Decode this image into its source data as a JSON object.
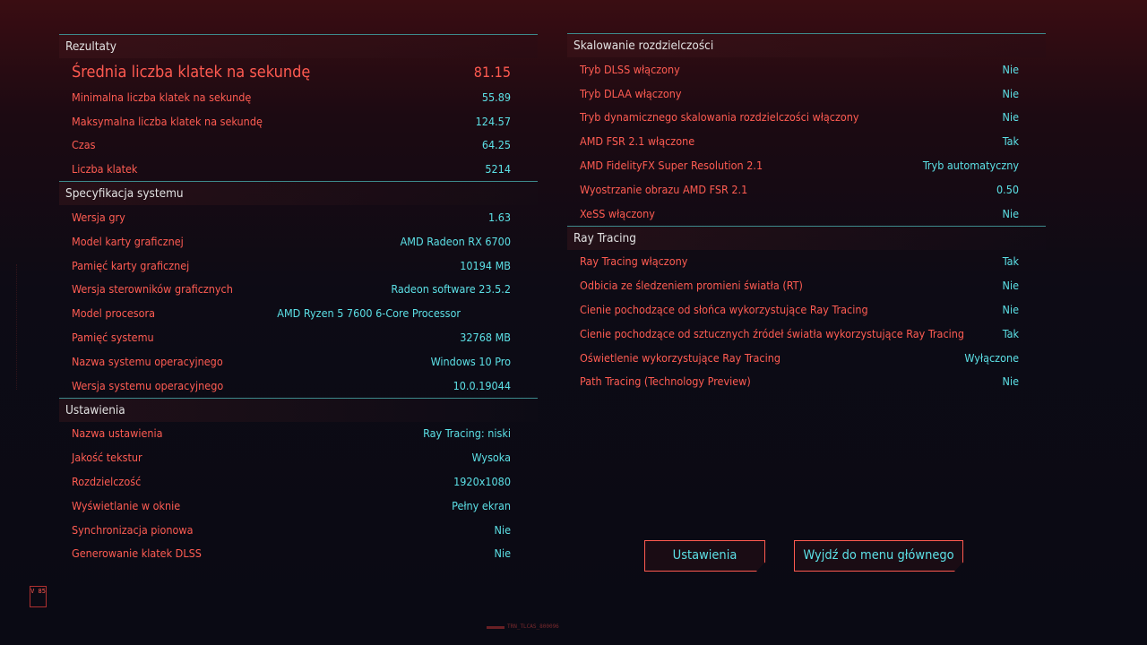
{
  "results": {
    "title": "Rezultaty",
    "rows": [
      {
        "label": "Średnia liczba klatek na sekundę",
        "value": "81.15"
      },
      {
        "label": "Minimalna liczba klatek na sekundę",
        "value": "55.89"
      },
      {
        "label": "Maksymalna liczba klatek na sekundę",
        "value": "124.57"
      },
      {
        "label": "Czas",
        "value": "64.25"
      },
      {
        "label": "Liczba klatek",
        "value": "5214"
      }
    ]
  },
  "system": {
    "title": "Specyfikacja systemu",
    "rows": [
      {
        "label": "Wersja gry",
        "value": "1.63"
      },
      {
        "label": "Model karty graficznej",
        "value": "AMD Radeon RX 6700"
      },
      {
        "label": "Pamięć karty graficznej",
        "value": "10194 MB"
      },
      {
        "label": "Wersja sterowników graficznych",
        "value": "Radeon software 23.5.2"
      },
      {
        "label": "Model procesora",
        "value": "AMD Ryzen 5 7600 6-Core Processor"
      },
      {
        "label": "Pamięć systemu",
        "value": "32768 MB"
      },
      {
        "label": "Nazwa systemu operacyjnego",
        "value": "Windows 10 Pro"
      },
      {
        "label": "Wersja systemu operacyjnego",
        "value": "10.0.19044"
      }
    ]
  },
  "settings": {
    "title": "Ustawienia",
    "rows": [
      {
        "label": "Nazwa ustawienia",
        "value": "Ray Tracing: niski"
      },
      {
        "label": "Jakość tekstur",
        "value": "Wysoka"
      },
      {
        "label": "Rozdzielczość",
        "value": "1920x1080"
      },
      {
        "label": "Wyświetlanie w oknie",
        "value": "Pełny ekran"
      },
      {
        "label": "Synchronizacja pionowa",
        "value": "Nie"
      },
      {
        "label": "Generowanie klatek DLSS",
        "value": "Nie"
      }
    ]
  },
  "scaling": {
    "title": "Skalowanie rozdzielczości",
    "rows": [
      {
        "label": "Tryb DLSS włączony",
        "value": "Nie"
      },
      {
        "label": "Tryb DLAA włączony",
        "value": "Nie"
      },
      {
        "label": "Tryb dynamicznego skalowania rozdzielczości włączony",
        "value": "Nie"
      },
      {
        "label": "AMD FSR 2.1 włączone",
        "value": "Tak"
      },
      {
        "label": "AMD FidelityFX Super Resolution 2.1",
        "value": "Tryb automatyczny"
      },
      {
        "label": "Wyostrzanie obrazu AMD FSR 2.1",
        "value": "0.50"
      },
      {
        "label": "XeSS włączony",
        "value": "Nie"
      }
    ]
  },
  "raytracing": {
    "title": "Ray Tracing",
    "rows": [
      {
        "label": "Ray Tracing włączony",
        "value": "Tak"
      },
      {
        "label": "Odbicia ze śledzeniem promieni światła (RT)",
        "value": "Nie"
      },
      {
        "label": "Cienie pochodzące od słońca wykorzystujące Ray Tracing",
        "value": "Nie"
      },
      {
        "label": "Cienie pochodzące od sztucznych źródeł światła wykorzystujące Ray Tracing",
        "value": "Tak"
      },
      {
        "label": "Oświetlenie wykorzystujące Ray Tracing",
        "value": "Wyłączone"
      },
      {
        "label": "Path Tracing (Technology Preview)",
        "value": "Nie"
      }
    ]
  },
  "buttons": {
    "settings": "Ustawienia",
    "exit": "Wyjdź do menu głównego"
  },
  "footer": {
    "code": "TRN_TLCAS_800096"
  },
  "logo": {
    "text": "V 85"
  },
  "colors": {
    "label": "#ff5c52",
    "value": "#5ce0e6",
    "divider": "#3d8a8c",
    "button_border": "#ff5a50"
  }
}
